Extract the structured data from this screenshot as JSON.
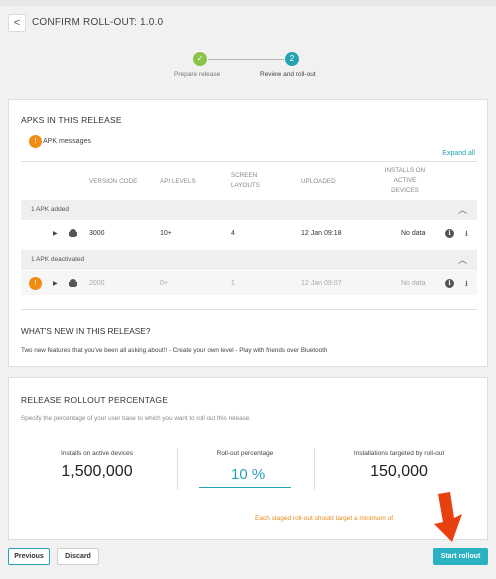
{
  "header": {
    "back_glyph": "<",
    "title": "CONFIRM ROLL-OUT: 1.0.0"
  },
  "steps": [
    {
      "label": "Prepare release",
      "glyph": "✓",
      "state": "done"
    },
    {
      "label": "Review and roll-out",
      "glyph": "2",
      "state": "active"
    }
  ],
  "apks": {
    "title": "APKS IN THIS RELEASE",
    "messages_badge": "!",
    "messages_label": "APK messages",
    "expand_all": "Expand all",
    "columns": {
      "version_code": "VERSION CODE",
      "api_levels": "API LEVELS",
      "screen_layouts": [
        "SCREEN",
        "LAYOUTS"
      ],
      "uploaded": "UPLOADED",
      "installs": [
        "INSTALLS ON",
        "ACTIVE",
        "DEVICES"
      ]
    },
    "groups": [
      {
        "label": "1 APK added",
        "rows": [
          {
            "version_code": "3000",
            "api_levels": "10+",
            "screen_layouts": "4",
            "uploaded": "12 Jan 09:18",
            "installs": "No data"
          }
        ]
      },
      {
        "label": "1 APK deactivated",
        "rows": [
          {
            "badge": "!",
            "version_code": "2000",
            "api_levels": "0+",
            "screen_layouts": "1",
            "uploaded": "12 Jan 09:07",
            "installs": "No data"
          }
        ]
      }
    ]
  },
  "whats_new": {
    "title": "WHAT'S NEW IN THIS RELEASE?",
    "body": "Two new features that you've been all asking about!! - Create your own level - Play with friends over Bluetooth"
  },
  "rollout": {
    "title": "RELEASE ROLLOUT PERCENTAGE",
    "description": "Specify the percentage of your user base to which you want to roll out this release.",
    "installs_label": "Installs on active devices",
    "installs_value": "1,500,000",
    "pct_label": "Roll-out percentage",
    "pct_value": "10 %",
    "targeted_label": "Installations targeted by roll-out",
    "targeted_value": "150,000",
    "warning": "Each staged roll-out should target a minimum of"
  },
  "footer": {
    "previous": "Previous",
    "discard": "Discard",
    "start": "Start rollout"
  },
  "icons": {
    "back": "chevron-left-icon",
    "android": "android-icon",
    "info": "info-icon",
    "download": "download-icon",
    "chevron_up": "chevron-up-icon",
    "caret": "caret-right-icon",
    "arrow": "red-arrow-pointer-icon"
  },
  "colors": {
    "accent": "#26a2b3",
    "success": "#8bc34a",
    "warning": "#ef8c16",
    "arrow": "#e8400f",
    "start_button": "#2bb1c1"
  }
}
